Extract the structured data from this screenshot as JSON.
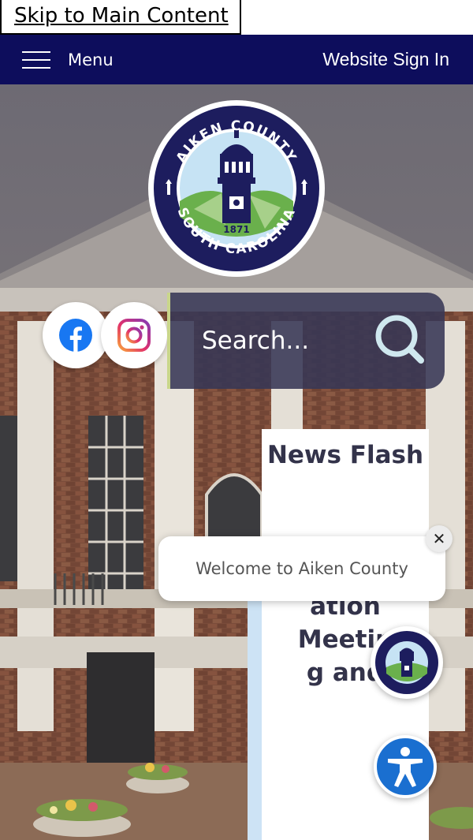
{
  "skip_link": {
    "label": "Skip to Main Content"
  },
  "nav": {
    "menu_label": "Menu",
    "signin_label": "Website Sign In",
    "bg_color": "#0d0d5c"
  },
  "logo": {
    "top_text": "AIKEN COUNTY",
    "bottom_text": "SOUTH CAROLINA",
    "year": "1871"
  },
  "social": {
    "facebook": "facebook-icon",
    "instagram": "instagram-icon"
  },
  "search": {
    "placeholder": "Search...",
    "icon": "search-icon"
  },
  "news_flash": {
    "title": "News Flash",
    "item_label": "Public Information Meeting and"
  },
  "welcome": {
    "message": "Welcome to Aiken County",
    "close_glyph": "✕"
  },
  "accessibility": {
    "icon": "accessibility-icon",
    "color": "#1a6fd0"
  }
}
